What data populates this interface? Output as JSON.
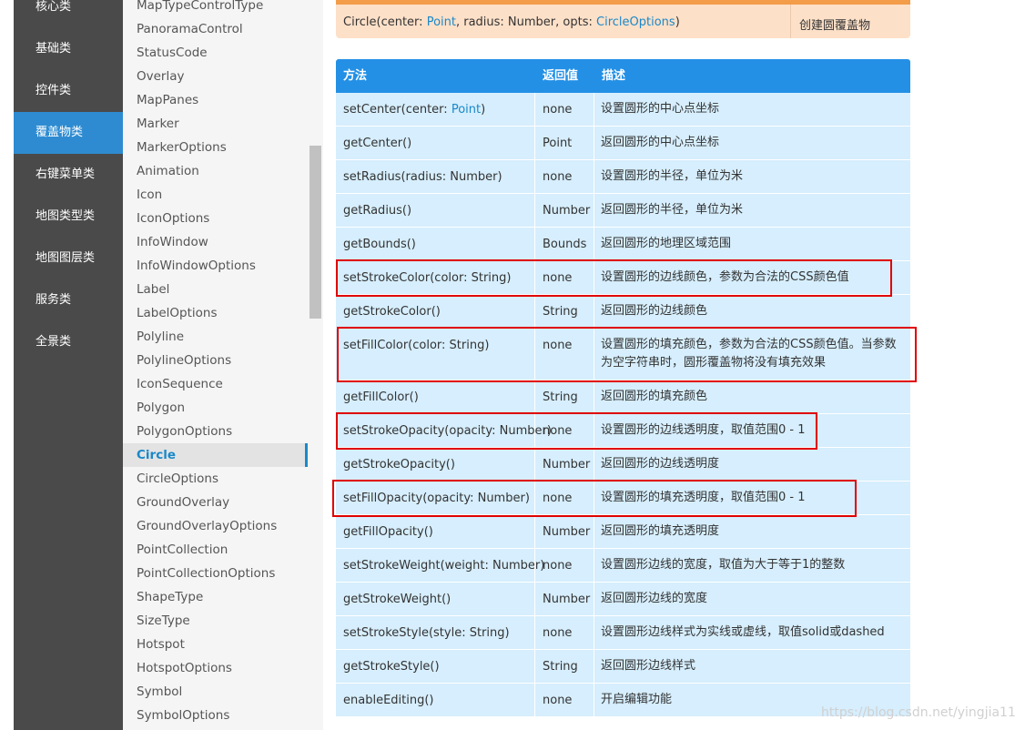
{
  "catnav": [
    {
      "label": "核心类",
      "active": false
    },
    {
      "label": "基础类",
      "active": false
    },
    {
      "label": "控件类",
      "active": false
    },
    {
      "label": "覆盖物类",
      "active": true
    },
    {
      "label": "右键菜单类",
      "active": false
    },
    {
      "label": "地图类型类",
      "active": false
    },
    {
      "label": "地图图层类",
      "active": false
    },
    {
      "label": "服务类",
      "active": false
    },
    {
      "label": "全景类",
      "active": false
    }
  ],
  "classlist": [
    {
      "label": "MapTypeControlType",
      "active": false
    },
    {
      "label": "PanoramaControl",
      "active": false
    },
    {
      "label": "StatusCode",
      "active": false
    },
    {
      "label": "Overlay",
      "active": false
    },
    {
      "label": "MapPanes",
      "active": false
    },
    {
      "label": "Marker",
      "active": false
    },
    {
      "label": "MarkerOptions",
      "active": false
    },
    {
      "label": "Animation",
      "active": false
    },
    {
      "label": "Icon",
      "active": false
    },
    {
      "label": "IconOptions",
      "active": false
    },
    {
      "label": "InfoWindow",
      "active": false
    },
    {
      "label": "InfoWindowOptions",
      "active": false
    },
    {
      "label": "Label",
      "active": false
    },
    {
      "label": "LabelOptions",
      "active": false
    },
    {
      "label": "Polyline",
      "active": false
    },
    {
      "label": "PolylineOptions",
      "active": false
    },
    {
      "label": "IconSequence",
      "active": false
    },
    {
      "label": "Polygon",
      "active": false
    },
    {
      "label": "PolygonOptions",
      "active": false
    },
    {
      "label": "Circle",
      "active": true
    },
    {
      "label": "CircleOptions",
      "active": false
    },
    {
      "label": "GroundOverlay",
      "active": false
    },
    {
      "label": "GroundOverlayOptions",
      "active": false
    },
    {
      "label": "PointCollection",
      "active": false
    },
    {
      "label": "PointCollectionOptions",
      "active": false
    },
    {
      "label": "ShapeType",
      "active": false
    },
    {
      "label": "SizeType",
      "active": false
    },
    {
      "label": "Hotspot",
      "active": false
    },
    {
      "label": "HotspotOptions",
      "active": false
    },
    {
      "label": "Symbol",
      "active": false
    },
    {
      "label": "SymbolOptions",
      "active": false
    }
  ],
  "constructor": {
    "signature_prefix": "Circle(center: ",
    "signature_link1": "Point",
    "signature_mid": ", radius: Number, opts: ",
    "signature_link2": "CircleOptions",
    "signature_suffix": ")",
    "description": "创建圆覆盖物"
  },
  "methods": {
    "headers": {
      "method": "方法",
      "return": "返回值",
      "desc": "描述"
    },
    "rows": [
      {
        "method_prefix": "setCenter(center: ",
        "method_link": "Point",
        "method_suffix": ")",
        "ret": "none",
        "ret_link": false,
        "desc": "设置圆形的中心点坐标",
        "highlight": false
      },
      {
        "method_prefix": "getCenter()",
        "method_link": "",
        "method_suffix": "",
        "ret": "Point",
        "ret_link": true,
        "desc": "返回圆形的中心点坐标",
        "highlight": false
      },
      {
        "method_prefix": "setRadius(radius: Number)",
        "method_link": "",
        "method_suffix": "",
        "ret": "none",
        "ret_link": false,
        "desc": "设置圆形的半径，单位为米",
        "highlight": false
      },
      {
        "method_prefix": "getRadius()",
        "method_link": "",
        "method_suffix": "",
        "ret": "Number",
        "ret_link": false,
        "desc": "返回圆形的半径，单位为米",
        "highlight": false
      },
      {
        "method_prefix": "getBounds()",
        "method_link": "",
        "method_suffix": "",
        "ret": "Bounds",
        "ret_link": true,
        "desc": "返回圆形的地理区域范围",
        "highlight": false
      },
      {
        "method_prefix": "setStrokeColor(color: String)",
        "method_link": "",
        "method_suffix": "",
        "ret": "none",
        "ret_link": false,
        "desc": "设置圆形的边线颜色，参数为合法的CSS颜色值",
        "highlight": true
      },
      {
        "method_prefix": "getStrokeColor()",
        "method_link": "",
        "method_suffix": "",
        "ret": "String",
        "ret_link": false,
        "desc": "返回圆形的边线颜色",
        "highlight": false
      },
      {
        "method_prefix": "setFillColor(color: String)",
        "method_link": "",
        "method_suffix": "",
        "ret": "none",
        "ret_link": false,
        "desc": "设置圆形的填充颜色，参数为合法的CSS颜色值。当参数为空字符串时，圆形覆盖物将没有填充效果",
        "highlight": true
      },
      {
        "method_prefix": "getFillColor()",
        "method_link": "",
        "method_suffix": "",
        "ret": "String",
        "ret_link": false,
        "desc": "返回圆形的填充颜色",
        "highlight": false
      },
      {
        "method_prefix": "setStrokeOpacity(opacity: Number)",
        "method_link": "",
        "method_suffix": "",
        "ret": "none",
        "ret_link": false,
        "desc": "设置圆形的边线透明度，取值范围0 - 1",
        "highlight": true
      },
      {
        "method_prefix": "getStrokeOpacity()",
        "method_link": "",
        "method_suffix": "",
        "ret": "Number",
        "ret_link": false,
        "desc": "返回圆形的边线透明度",
        "highlight": false
      },
      {
        "method_prefix": "setFillOpacity(opacity: Number)",
        "method_link": "",
        "method_suffix": "",
        "ret": "none",
        "ret_link": false,
        "desc": "设置圆形的填充透明度，取值范围0 - 1",
        "highlight": true
      },
      {
        "method_prefix": "getFillOpacity()",
        "method_link": "",
        "method_suffix": "",
        "ret": "Number",
        "ret_link": false,
        "desc": "返回圆形的填充透明度",
        "highlight": false
      },
      {
        "method_prefix": "setStrokeWeight(weight: Number)",
        "method_link": "",
        "method_suffix": "",
        "ret": "none",
        "ret_link": false,
        "desc": "设置圆形边线的宽度，取值为大于等于1的整数",
        "highlight": false
      },
      {
        "method_prefix": "getStrokeWeight()",
        "method_link": "",
        "method_suffix": "",
        "ret": "Number",
        "ret_link": false,
        "desc": "返回圆形边线的宽度",
        "highlight": false
      },
      {
        "method_prefix": "setStrokeStyle(style: String)",
        "method_link": "",
        "method_suffix": "",
        "ret": "none",
        "ret_link": false,
        "desc": "设置圆形边线样式为实线或虚线，取值solid或dashed",
        "highlight": false
      },
      {
        "method_prefix": "getStrokeStyle()",
        "method_link": "",
        "method_suffix": "",
        "ret": "String",
        "ret_link": false,
        "desc": "返回圆形边线样式",
        "highlight": false
      },
      {
        "method_prefix": "enableEditing()",
        "method_link": "",
        "method_suffix": "",
        "ret": "none",
        "ret_link": false,
        "desc": "开启编辑功能",
        "highlight": false
      }
    ]
  },
  "watermark": "https://blog.csdn.net/yingjia11",
  "colors": {
    "nav_bg": "#4a4a4a",
    "nav_active": "#2e8bd1",
    "table_head": "#2390e6",
    "row_bg": "#d6eefd",
    "highlight": "#e00000",
    "link": "#1a88c9"
  }
}
